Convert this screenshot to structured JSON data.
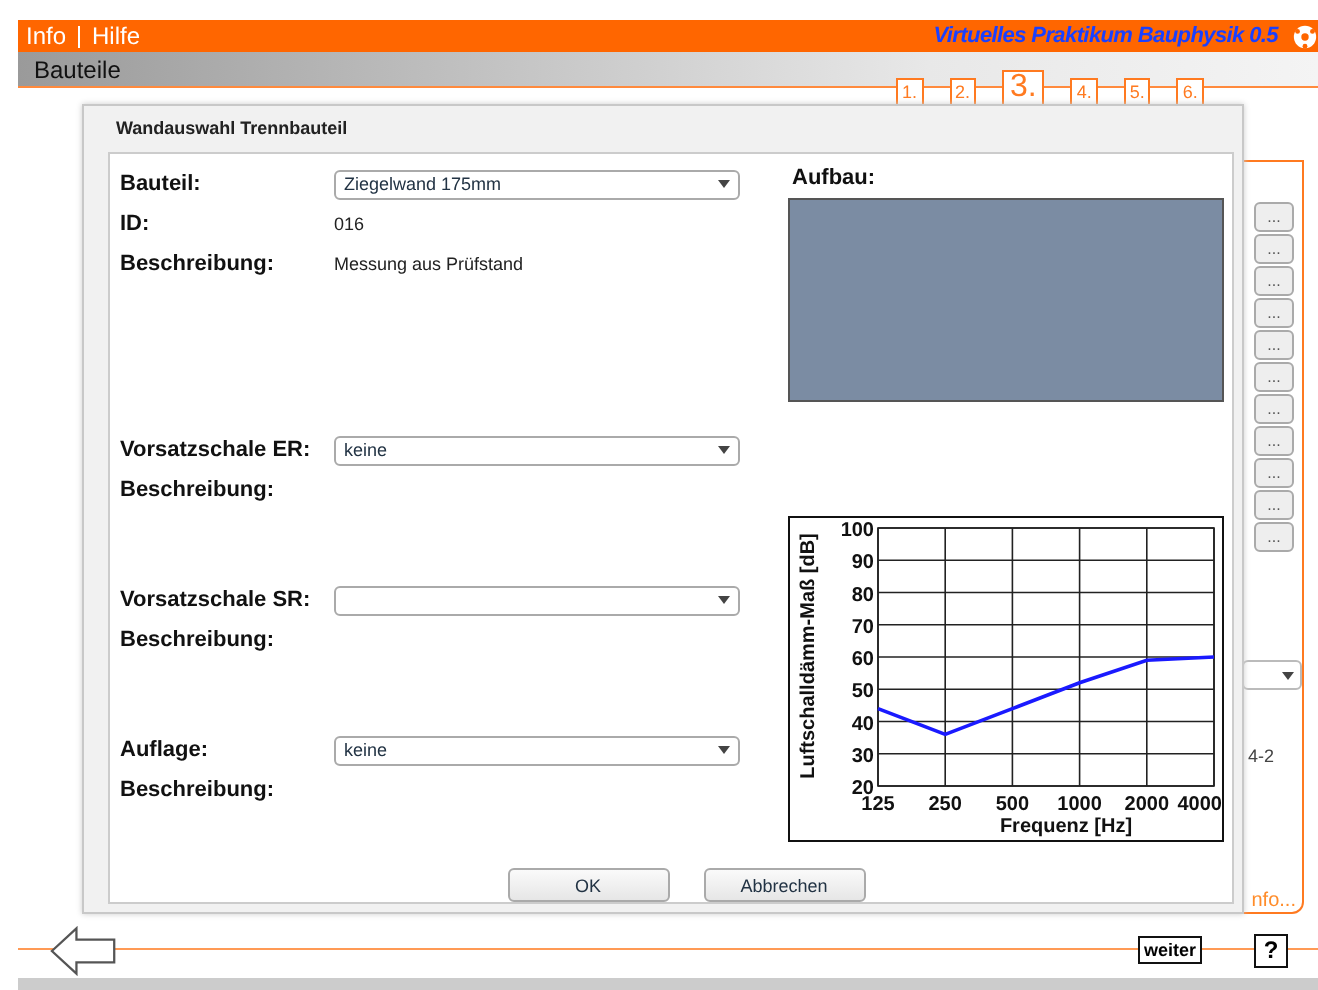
{
  "menu": [
    "Info",
    "Hilfe"
  ],
  "app_title": "Virtuelles Praktikum Bauphysik  0.5",
  "section_title": "Bauteile",
  "steps": [
    {
      "label": "1.",
      "selected": false
    },
    {
      "label": "2.",
      "selected": false
    },
    {
      "label": "3.",
      "selected": true
    },
    {
      "label": "4.",
      "selected": false
    },
    {
      "label": "5.",
      "selected": false
    },
    {
      "label": "6.",
      "selected": false
    }
  ],
  "side_panel": {
    "buttons": [
      "...",
      "...",
      "...",
      "...",
      "...",
      "...",
      "...",
      "...",
      "...",
      "...",
      "..."
    ],
    "code": "4-2",
    "link": "nfo..."
  },
  "dialog": {
    "title": "Wandauswahl Trennbauteil",
    "sections": [
      {
        "label": "Bauteil:",
        "value": "Ziegelwand 175mm",
        "id_label": "ID:",
        "id": "016",
        "description_label": "Beschreibung:",
        "description": "Messung aus Prüfstand"
      },
      {
        "label": "Vorsatzschale ER:",
        "value": "keine",
        "description_label": "Beschreibung:"
      },
      {
        "label": "Vorsatzschale SR:",
        "description_label": "Beschreibung:"
      },
      {
        "label": "Auflage:",
        "value": "keine",
        "description_label": "Beschreibung:"
      }
    ],
    "aufbau_label": "Aufbau:",
    "chart_data": {
      "type": "line",
      "xlabel": "Frequenz [Hz]",
      "ylabel": "Luftschalldämm-Maß [dB]",
      "categories": [
        "125",
        "250",
        "500",
        "1000",
        "2000",
        "4000"
      ],
      "series": [
        {
          "color": "#1a1aff",
          "values": [
            44,
            36,
            44,
            52,
            59,
            60
          ]
        }
      ],
      "grid": true,
      "ylim": [
        20,
        100
      ],
      "yticks": [
        20,
        30,
        40,
        50,
        60,
        70,
        80,
        90,
        100
      ]
    },
    "buttons": [
      "OK",
      "Abbrechen"
    ]
  },
  "footer": {
    "next": "weiter",
    "help": "?"
  }
}
